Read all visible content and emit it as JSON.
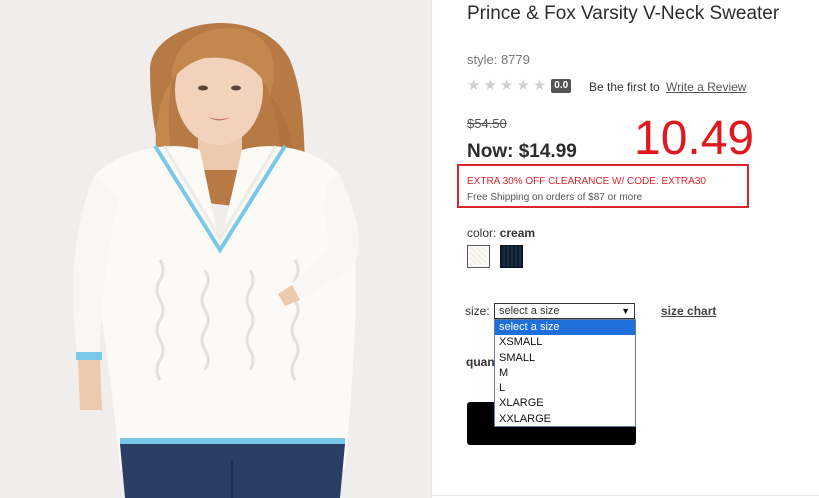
{
  "product": {
    "title": "Prince & Fox Varsity V-Neck Sweater",
    "style": "style: 8779",
    "rating": {
      "stars": 0,
      "max_stars": 5,
      "badge": "0.0",
      "lead_text": "Be the first to",
      "link_text": "Write a Review"
    },
    "was_price": "$54.50",
    "now_price": "Now: $14.99",
    "promo": {
      "code_text": "EXTRA 30% OFF CLEARANCE W/ CODE: EXTRA30",
      "shipping_text": "Free Shipping on orders of $87 or more"
    },
    "annotation": "10.49",
    "color": {
      "label": "color:",
      "selected": "cream",
      "swatches": [
        {
          "name": "cream",
          "hex": "#fbfaf6"
        },
        {
          "name": "navy",
          "hex": "#13213a"
        }
      ]
    },
    "size": {
      "label": "size:",
      "selected": "select a size",
      "chart_link": "size chart",
      "options": [
        "select a size",
        "XSMALL",
        "SMALL",
        "M",
        "L",
        "XLARGE",
        "XXLARGE"
      ]
    },
    "quantity_label": "quantity"
  },
  "colors": {
    "accent_red": "#d9262c",
    "highlight_blue": "#1e6fd9",
    "trim_blue": "#7ac8e8"
  }
}
